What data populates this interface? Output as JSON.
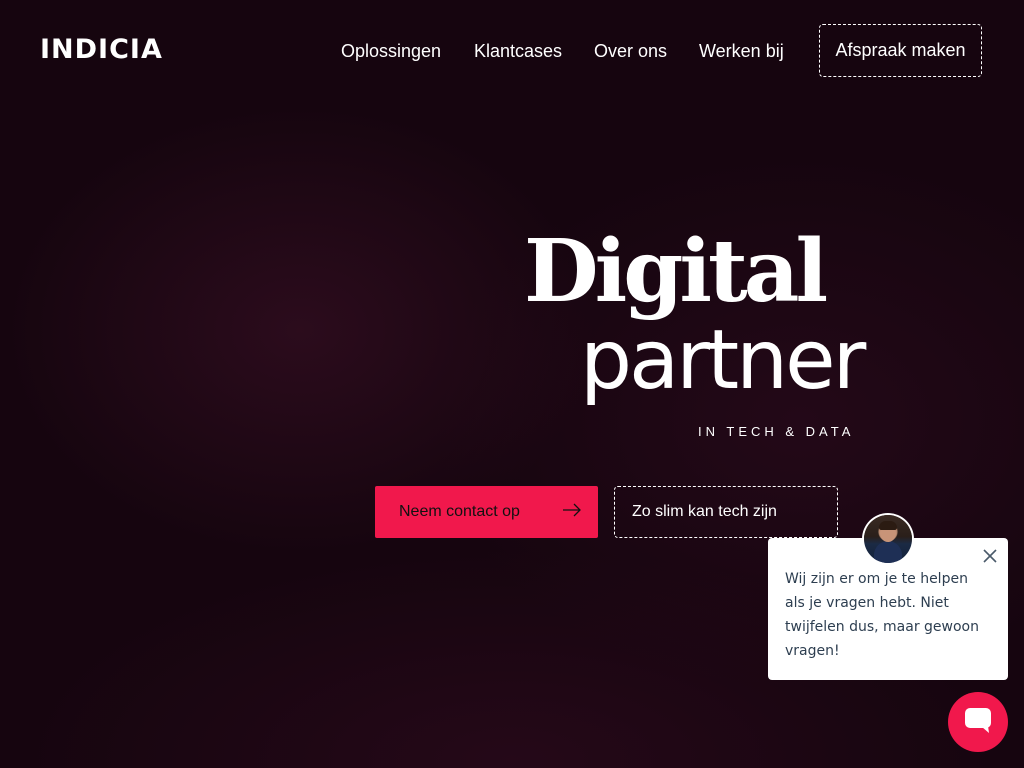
{
  "header": {
    "logo": "INDICIA",
    "nav": [
      {
        "label": "Oplossingen"
      },
      {
        "label": "Klantcases"
      },
      {
        "label": "Over ons"
      },
      {
        "label": "Werken bij"
      }
    ],
    "cta_label": "Afspraak maken"
  },
  "hero": {
    "headline_line1": "Digital",
    "headline_line2": "partner",
    "tagline": "IN TECH & DATA",
    "primary_button": "Neem contact op",
    "secondary_button": "Zo slim kan tech zijn"
  },
  "chat": {
    "message": "Wij zijn er om je te helpen als je vragen hebt. Niet twijfelen dus, maar gewoon vragen!",
    "accent_color": "#f1184c"
  },
  "icons": {
    "arrow": "arrow-right-icon",
    "close": "close-icon",
    "chat": "chat-bubble-icon"
  },
  "colors": {
    "background": "#16050f",
    "accent": "#f1184c",
    "text": "#ffffff"
  }
}
